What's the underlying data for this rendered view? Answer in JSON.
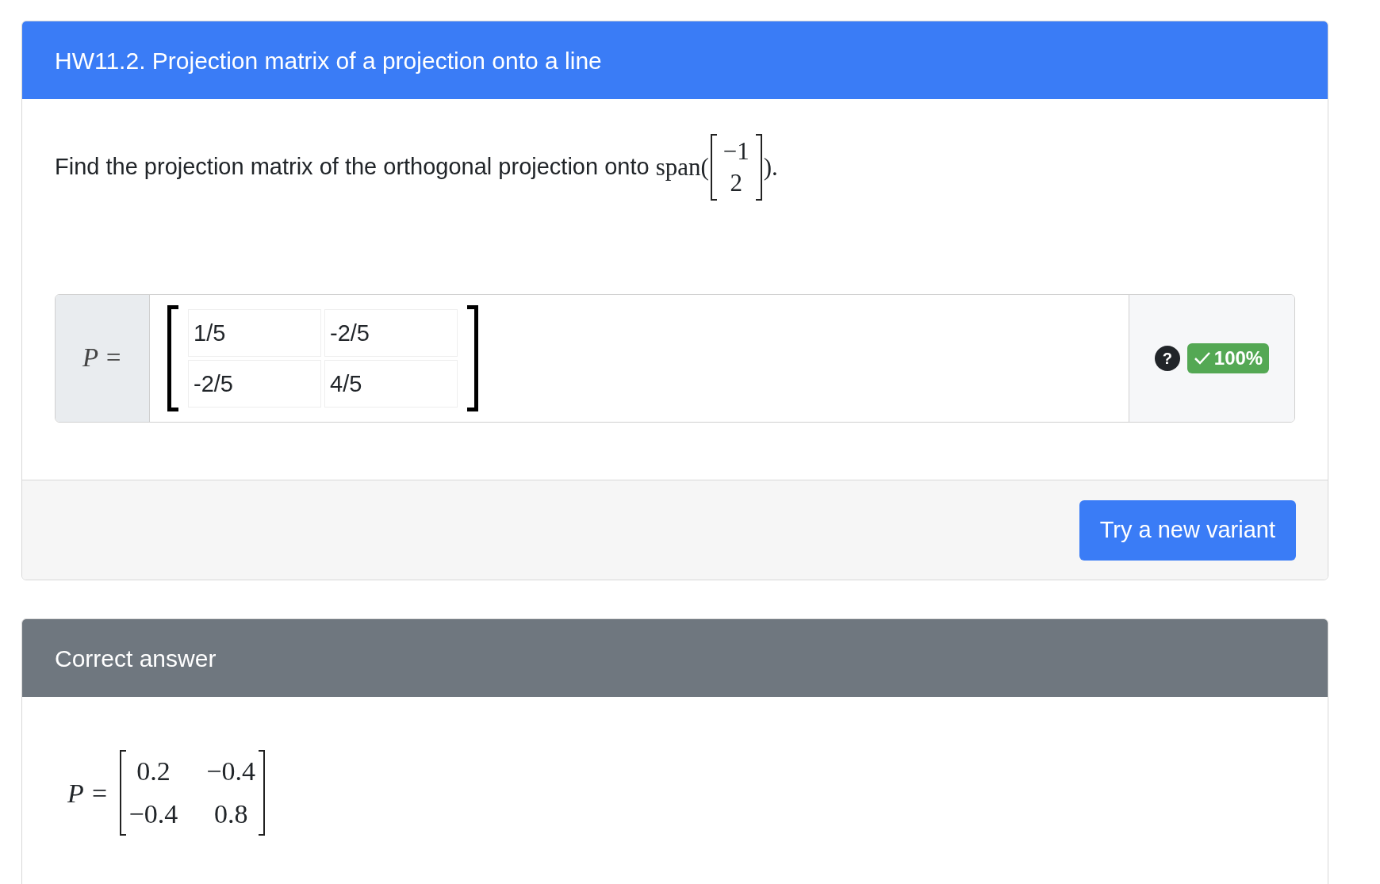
{
  "question_card": {
    "title": "HW11.2. Projection matrix of a projection onto a line",
    "question": {
      "text": "Find the projection matrix of the orthogonal projection onto",
      "math_open": "span(",
      "vector": [
        "−1",
        "2"
      ],
      "math_close": ")."
    },
    "answer": {
      "label": "P =",
      "cells": [
        [
          "1/5",
          "-2/5"
        ],
        [
          "-2/5",
          "4/5"
        ]
      ],
      "help": "?",
      "score": {
        "text": "100%",
        "correct": true
      }
    },
    "button": "Try a new variant"
  },
  "correct_answer_card": {
    "title": "Correct answer",
    "label": "P =",
    "matrix": [
      [
        "0.2",
        "−0.4"
      ],
      [
        "−0.4",
        "0.8"
      ]
    ]
  }
}
